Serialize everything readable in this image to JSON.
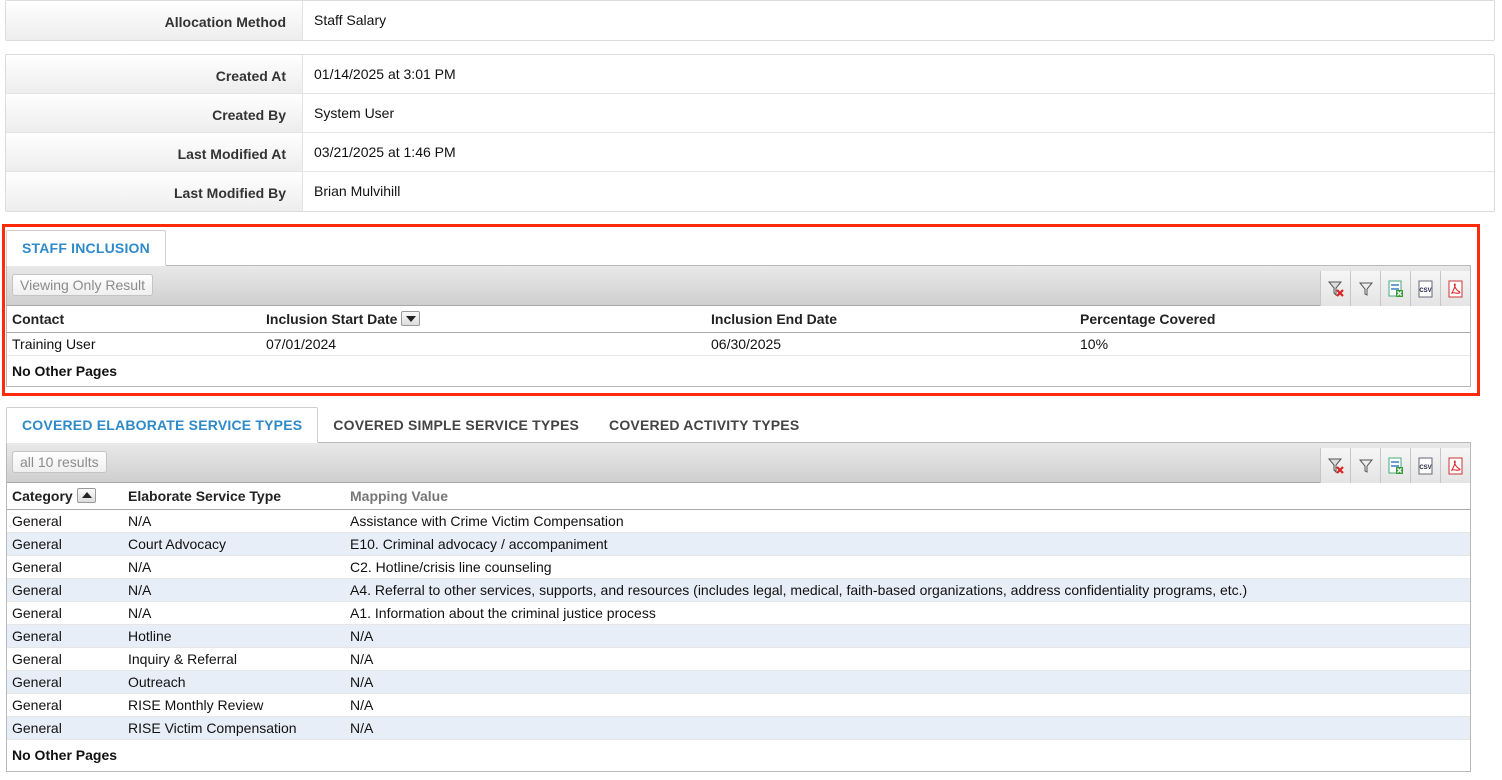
{
  "allocation": {
    "label": "Allocation Method",
    "value": "Staff Salary"
  },
  "audit": [
    {
      "label": "Created At",
      "value": "01/14/2025 at 3:01 PM"
    },
    {
      "label": "Created By",
      "value": "System User"
    },
    {
      "label": "Last Modified At",
      "value": "03/21/2025 at 1:46 PM"
    },
    {
      "label": "Last Modified By",
      "value": "Brian Mulvihill"
    }
  ],
  "staff_inclusion": {
    "tab_label": "STAFF INCLUSION",
    "result_label": "Viewing Only Result",
    "columns": [
      "Contact",
      "Inclusion Start Date",
      "Inclusion End Date",
      "Percentage Covered"
    ],
    "rows": [
      [
        "Training User",
        "07/01/2024",
        "06/30/2025",
        "10%"
      ]
    ],
    "pager": "No Other Pages"
  },
  "covered": {
    "tabs": [
      "COVERED ELABORATE SERVICE TYPES",
      "COVERED SIMPLE SERVICE TYPES",
      "COVERED ACTIVITY TYPES"
    ],
    "result_label": "all 10 results",
    "columns": [
      "Category",
      "Elaborate Service Type",
      "Mapping Value"
    ],
    "rows": [
      [
        "General",
        "N/A",
        "Assistance with Crime Victim Compensation"
      ],
      [
        "General",
        "Court Advocacy",
        "E10. Criminal advocacy / accompaniment"
      ],
      [
        "General",
        "N/A",
        "C2. Hotline/crisis line counseling"
      ],
      [
        "General",
        "N/A",
        "A4. Referral to other services, supports, and resources (includes legal, medical, faith-based organizations, address confidentiality programs, etc.)"
      ],
      [
        "General",
        "N/A",
        "A1. Information about the criminal justice process"
      ],
      [
        "General",
        "Hotline",
        "N/A"
      ],
      [
        "General",
        "Inquiry & Referral",
        "N/A"
      ],
      [
        "General",
        "Outreach",
        "N/A"
      ],
      [
        "General",
        "RISE Monthly Review",
        "N/A"
      ],
      [
        "General",
        "RISE Victim Compensation",
        "N/A"
      ]
    ],
    "pager": "No Other Pages"
  },
  "toolbar_icons": [
    "clear-filter-icon",
    "filter-icon",
    "excel-export-icon",
    "csv-export-icon",
    "pdf-export-icon"
  ],
  "colors": {
    "active_tab": "#2f8ac8",
    "highlight": "#ff2a0a",
    "alt_row": "#e8eef7"
  },
  "icon_text": {
    "csv": "CSV"
  }
}
